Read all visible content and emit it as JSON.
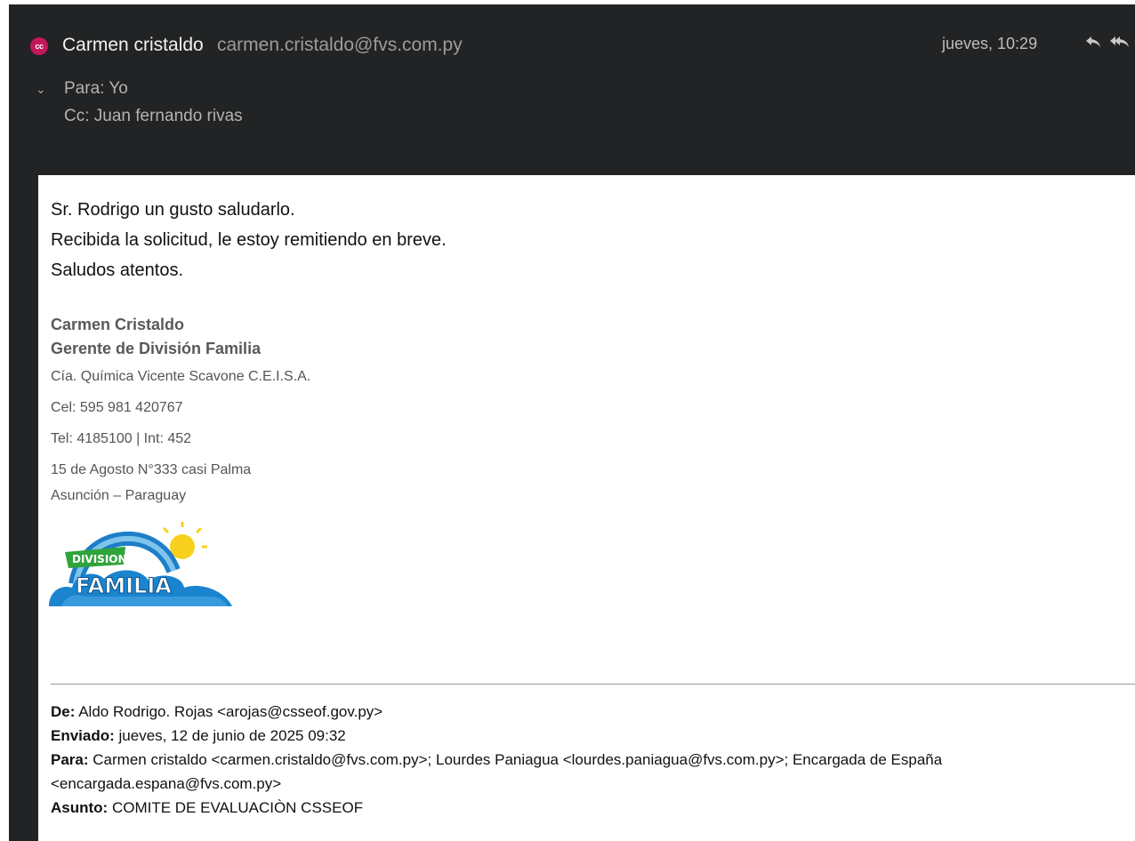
{
  "header": {
    "avatar_initials": "cc",
    "avatar_color": "#c2185b",
    "sender_name": "Carmen cristaldo",
    "sender_email": "carmen.cristaldo@fvs.com.py",
    "date": "jueves, 10:29",
    "to_label": "Para:",
    "to_value": "Yo",
    "cc_label": "Cc:",
    "cc_value": "Juan fernando rivas"
  },
  "message": {
    "lines": [
      "Sr. Rodrigo un gusto saludarlo.",
      "Recibida la solicitud, le estoy remitiendo en breve.",
      "Saludos atentos."
    ]
  },
  "signature": {
    "name": "Carmen Cristaldo",
    "role": "Gerente de División Familia",
    "company": "Cía. Química Vicente Scavone C.E.I.S.A.",
    "cel": "Cel: 595 981 420767",
    "tel": "Tel: 4185100 | Int: 452",
    "address1": "15 de Agosto N°333 casi Palma",
    "address2": "Asunción – Paraguay",
    "logo_line1": "DIVISION",
    "logo_line2": "FAMILIA"
  },
  "forwarded": {
    "from_label": "De:",
    "from_value": "Aldo Rodrigo. Rojas <arojas@csseof.gov.py>",
    "sent_label": "Enviado:",
    "sent_value": "jueves, 12 de junio de 2025 09:32",
    "to_label": "Para:",
    "to_value": "Carmen cristaldo <carmen.cristaldo@fvs.com.py>; Lourdes Paniagua <lourdes.paniagua@fvs.com.py>; Encargada de España <encargada.espana@fvs.com.py>",
    "subject_label": "Asunto:",
    "subject_value": "COMITE DE EVALUACIÒN CSSEOF"
  }
}
